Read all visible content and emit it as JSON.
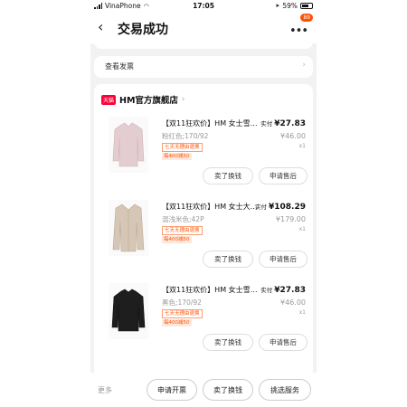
{
  "status_bar": {
    "carrier": "VinaPhone",
    "time": "17:05",
    "battery": "59%"
  },
  "nav": {
    "back_icon": "chevron-left",
    "title": "交易成功",
    "menu_icon": "more-dots",
    "badge": "89"
  },
  "invoice": {
    "label": "查看发票",
    "chevron_icon": "chevron-right"
  },
  "shop": {
    "tmall_badge": "天猫",
    "name": "HM官方旗舰店",
    "chevron": "›"
  },
  "items": [
    {
      "name": "【双11狂欢价】HM 女士雪纺…",
      "sku": "粉红色;170/92",
      "tag_return": "七天无理由退换",
      "tag_promo": "每400减50",
      "paid_label": "实付",
      "paid": "¥27.83",
      "original": "¥46.00",
      "qty": "x1",
      "sell_btn": "卖了换钱",
      "after_btn": "申请售后",
      "thumb_color": "#e4cdd0"
    },
    {
      "name": "【双11狂欢价】HM 女士大衣…",
      "sku": "混浅米色;42P",
      "tag_return": "七天无理由退换",
      "tag_promo": "每400减50",
      "paid_label": "实付",
      "paid": "¥108.29",
      "original": "¥179.00",
      "qty": "x1",
      "sell_btn": "卖了换钱",
      "after_btn": "申请售后",
      "thumb_color": "#d6c6b6"
    },
    {
      "name": "【双11狂欢价】HM 女士雪纺…",
      "sku": "黑色;170/92",
      "tag_return": "七天无理由退换",
      "tag_promo": "每400减50",
      "paid_label": "实付",
      "paid": "¥27.83",
      "original": "¥46.00",
      "qty": "x1",
      "sell_btn": "卖了换钱",
      "after_btn": "申请售后",
      "thumb_color": "#1e1e1e"
    }
  ],
  "bottom": {
    "more": "更多",
    "invoice_btn": "申请开票",
    "sell_btn": "卖了换钱",
    "service_btn": "挑选服务"
  },
  "colors": {
    "accent": "#ff5000",
    "tmall": "#ff0036",
    "background": "#f2f2f2"
  }
}
